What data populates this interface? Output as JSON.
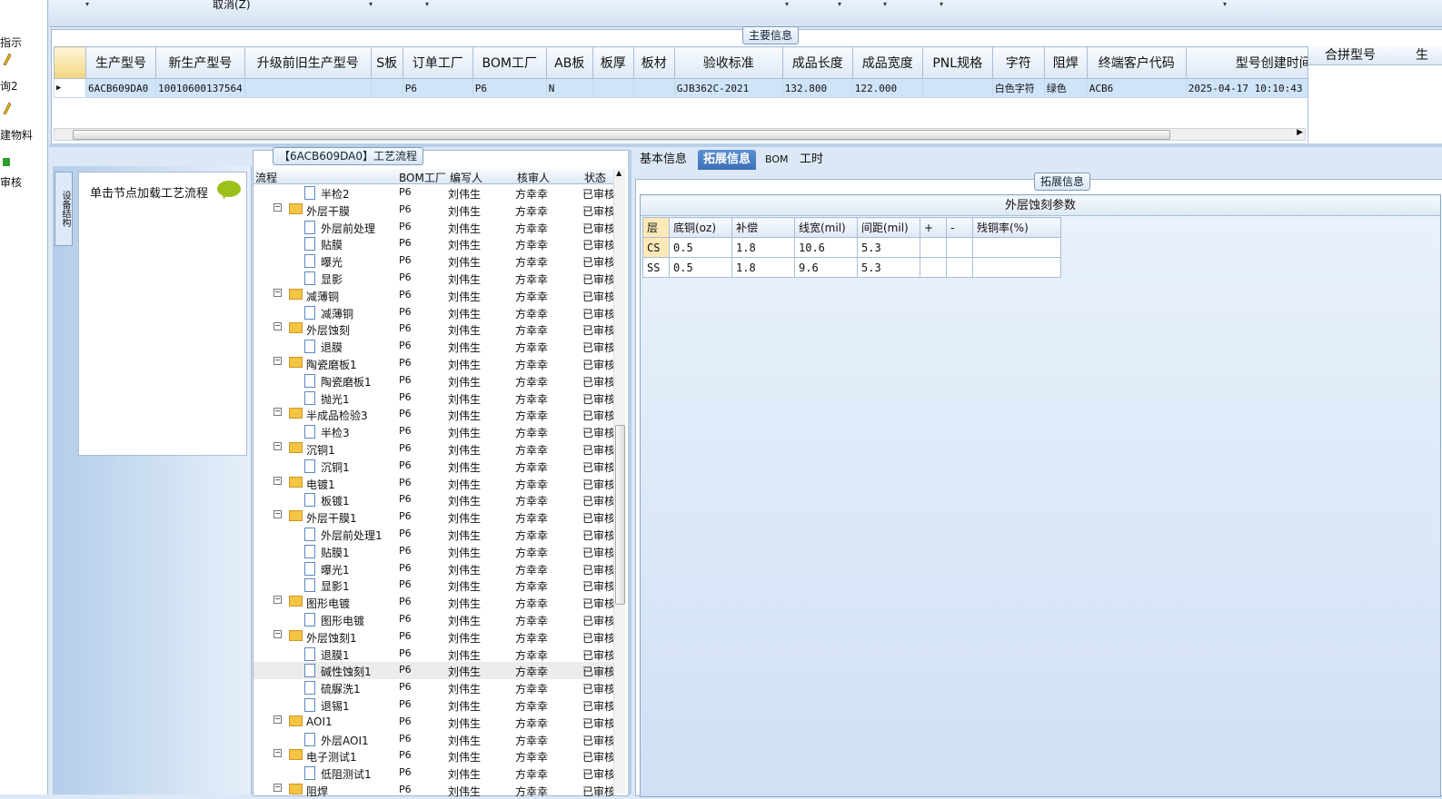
{
  "nav": {
    "items": [
      {
        "label": "指示"
      },
      {
        "label": "询2"
      },
      {
        "label": "建物料"
      },
      {
        "label": "审核"
      }
    ]
  },
  "toolbar": {
    "cancel_label": "取消(Z)"
  },
  "main_info": {
    "title": "主要信息",
    "columns": [
      "生产型号",
      "新生产型号",
      "升级前旧生产型号",
      "S板",
      "订单工厂",
      "BOM工厂",
      "AB板",
      "板厚",
      "板材",
      "验收标准",
      "成品长度",
      "成品宽度",
      "PNL规格",
      "字符",
      "阻焊",
      "终端客户代码",
      "型号创建时间"
    ],
    "row": [
      "6ACB609DA0",
      "10010600137564",
      "",
      "",
      "P6",
      "P6",
      "N",
      "",
      "",
      "GJB362C-2021",
      "132.800",
      "122.000",
      "",
      "白色字符",
      "绿色",
      "ACB6",
      "2025-04-17 10:10:43"
    ],
    "merge_header": "合拼型号",
    "merge_header2": "生"
  },
  "left_panel": {
    "vertical_tab": "设备结构",
    "hint": "单击节点加载工艺流程"
  },
  "process": {
    "title": "【6ACB609DA0】工艺流程",
    "headers": {
      "flow": "流程",
      "bom": "BOM工厂",
      "writer": "编写人",
      "checker": "核审人",
      "status": "状态"
    },
    "rows": [
      {
        "level": 2,
        "name": "半检2",
        "bom": "P6",
        "writer": "刘伟生",
        "checker": "方幸幸",
        "status": "已审核"
      },
      {
        "level": 1,
        "name": "外层干膜",
        "bom": "P6",
        "writer": "刘伟生",
        "checker": "方幸幸",
        "status": "已审核"
      },
      {
        "level": 2,
        "name": "外层前处理",
        "bom": "P6",
        "writer": "刘伟生",
        "checker": "方幸幸",
        "status": "已审核"
      },
      {
        "level": 2,
        "name": "贴膜",
        "bom": "P6",
        "writer": "刘伟生",
        "checker": "方幸幸",
        "status": "已审核"
      },
      {
        "level": 2,
        "name": "曝光",
        "bom": "P6",
        "writer": "刘伟生",
        "checker": "方幸幸",
        "status": "已审核"
      },
      {
        "level": 2,
        "name": "显影",
        "bom": "P6",
        "writer": "刘伟生",
        "checker": "方幸幸",
        "status": "已审核"
      },
      {
        "level": 1,
        "name": "减薄铜",
        "bom": "P6",
        "writer": "刘伟生",
        "checker": "方幸幸",
        "status": "已审核"
      },
      {
        "level": 2,
        "name": "减薄铜",
        "bom": "P6",
        "writer": "刘伟生",
        "checker": "方幸幸",
        "status": "已审核"
      },
      {
        "level": 1,
        "name": "外层蚀刻",
        "bom": "P6",
        "writer": "刘伟生",
        "checker": "方幸幸",
        "status": "已审核"
      },
      {
        "level": 2,
        "name": "退膜",
        "bom": "P6",
        "writer": "刘伟生",
        "checker": "方幸幸",
        "status": "已审核"
      },
      {
        "level": 1,
        "name": "陶瓷磨板1",
        "bom": "P6",
        "writer": "刘伟生",
        "checker": "方幸幸",
        "status": "已审核"
      },
      {
        "level": 2,
        "name": "陶瓷磨板1",
        "bom": "P6",
        "writer": "刘伟生",
        "checker": "方幸幸",
        "status": "已审核"
      },
      {
        "level": 2,
        "name": "抛光1",
        "bom": "P6",
        "writer": "刘伟生",
        "checker": "方幸幸",
        "status": "已审核"
      },
      {
        "level": 1,
        "name": "半成品检验3",
        "bom": "P6",
        "writer": "刘伟生",
        "checker": "方幸幸",
        "status": "已审核"
      },
      {
        "level": 2,
        "name": "半检3",
        "bom": "P6",
        "writer": "刘伟生",
        "checker": "方幸幸",
        "status": "已审核"
      },
      {
        "level": 1,
        "name": "沉铜1",
        "bom": "P6",
        "writer": "刘伟生",
        "checker": "方幸幸",
        "status": "已审核"
      },
      {
        "level": 2,
        "name": "沉铜1",
        "bom": "P6",
        "writer": "刘伟生",
        "checker": "方幸幸",
        "status": "已审核"
      },
      {
        "level": 1,
        "name": "电镀1",
        "bom": "P6",
        "writer": "刘伟生",
        "checker": "方幸幸",
        "status": "已审核"
      },
      {
        "level": 2,
        "name": "板镀1",
        "bom": "P6",
        "writer": "刘伟生",
        "checker": "方幸幸",
        "status": "已审核"
      },
      {
        "level": 1,
        "name": "外层干膜1",
        "bom": "P6",
        "writer": "刘伟生",
        "checker": "方幸幸",
        "status": "已审核"
      },
      {
        "level": 2,
        "name": "外层前处理1",
        "bom": "P6",
        "writer": "刘伟生",
        "checker": "方幸幸",
        "status": "已审核"
      },
      {
        "level": 2,
        "name": "贴膜1",
        "bom": "P6",
        "writer": "刘伟生",
        "checker": "方幸幸",
        "status": "已审核"
      },
      {
        "level": 2,
        "name": "曝光1",
        "bom": "P6",
        "writer": "刘伟生",
        "checker": "方幸幸",
        "status": "已审核"
      },
      {
        "level": 2,
        "name": "显影1",
        "bom": "P6",
        "writer": "刘伟生",
        "checker": "方幸幸",
        "status": "已审核"
      },
      {
        "level": 1,
        "name": "图形电镀",
        "bom": "P6",
        "writer": "刘伟生",
        "checker": "方幸幸",
        "status": "已审核"
      },
      {
        "level": 2,
        "name": "图形电镀",
        "bom": "P6",
        "writer": "刘伟生",
        "checker": "方幸幸",
        "status": "已审核"
      },
      {
        "level": 1,
        "name": "外层蚀刻1",
        "bom": "P6",
        "writer": "刘伟生",
        "checker": "方幸幸",
        "status": "已审核"
      },
      {
        "level": 2,
        "name": "退膜1",
        "bom": "P6",
        "writer": "刘伟生",
        "checker": "方幸幸",
        "status": "已审核"
      },
      {
        "level": 2,
        "name": "碱性蚀刻1",
        "bom": "P6",
        "writer": "刘伟生",
        "checker": "方幸幸",
        "status": "已审核",
        "selected": true
      },
      {
        "level": 2,
        "name": "硫脲洗1",
        "bom": "P6",
        "writer": "刘伟生",
        "checker": "方幸幸",
        "status": "已审核"
      },
      {
        "level": 2,
        "name": "退锡1",
        "bom": "P6",
        "writer": "刘伟生",
        "checker": "方幸幸",
        "status": "已审核"
      },
      {
        "level": 1,
        "name": "AOI1",
        "bom": "P6",
        "writer": "刘伟生",
        "checker": "方幸幸",
        "status": "已审核"
      },
      {
        "level": 2,
        "name": "外层AOI1",
        "bom": "P6",
        "writer": "刘伟生",
        "checker": "方幸幸",
        "status": "已审核"
      },
      {
        "level": 1,
        "name": "电子测试1",
        "bom": "P6",
        "writer": "刘伟生",
        "checker": "方幸幸",
        "status": "已审核"
      },
      {
        "level": 2,
        "name": "低阻测试1",
        "bom": "P6",
        "writer": "刘伟生",
        "checker": "方幸幸",
        "status": "已审核"
      },
      {
        "level": 1,
        "name": "阻焊",
        "bom": "P6",
        "writer": "刘伟生",
        "checker": "方幸幸",
        "status": "已审核"
      }
    ]
  },
  "tabs": {
    "items": [
      {
        "label": "基本信息"
      },
      {
        "label": "拓展信息",
        "active": true
      },
      {
        "label": "BOM"
      },
      {
        "label": "工时"
      }
    ]
  },
  "ext": {
    "group_title": "拓展信息",
    "table_title": "外层蚀刻参数",
    "headers": [
      "层",
      "底铜(oz)",
      "补偿",
      "线宽(mil)",
      "间距(mil)",
      "+",
      "-",
      "残铜率(%)"
    ],
    "rows": [
      [
        "CS",
        "0.5",
        "1.8",
        "10.6",
        "5.3",
        "",
        "",
        ""
      ],
      [
        "SS",
        "0.5",
        "1.8",
        "9.6",
        "5.3",
        "",
        "",
        ""
      ]
    ]
  }
}
